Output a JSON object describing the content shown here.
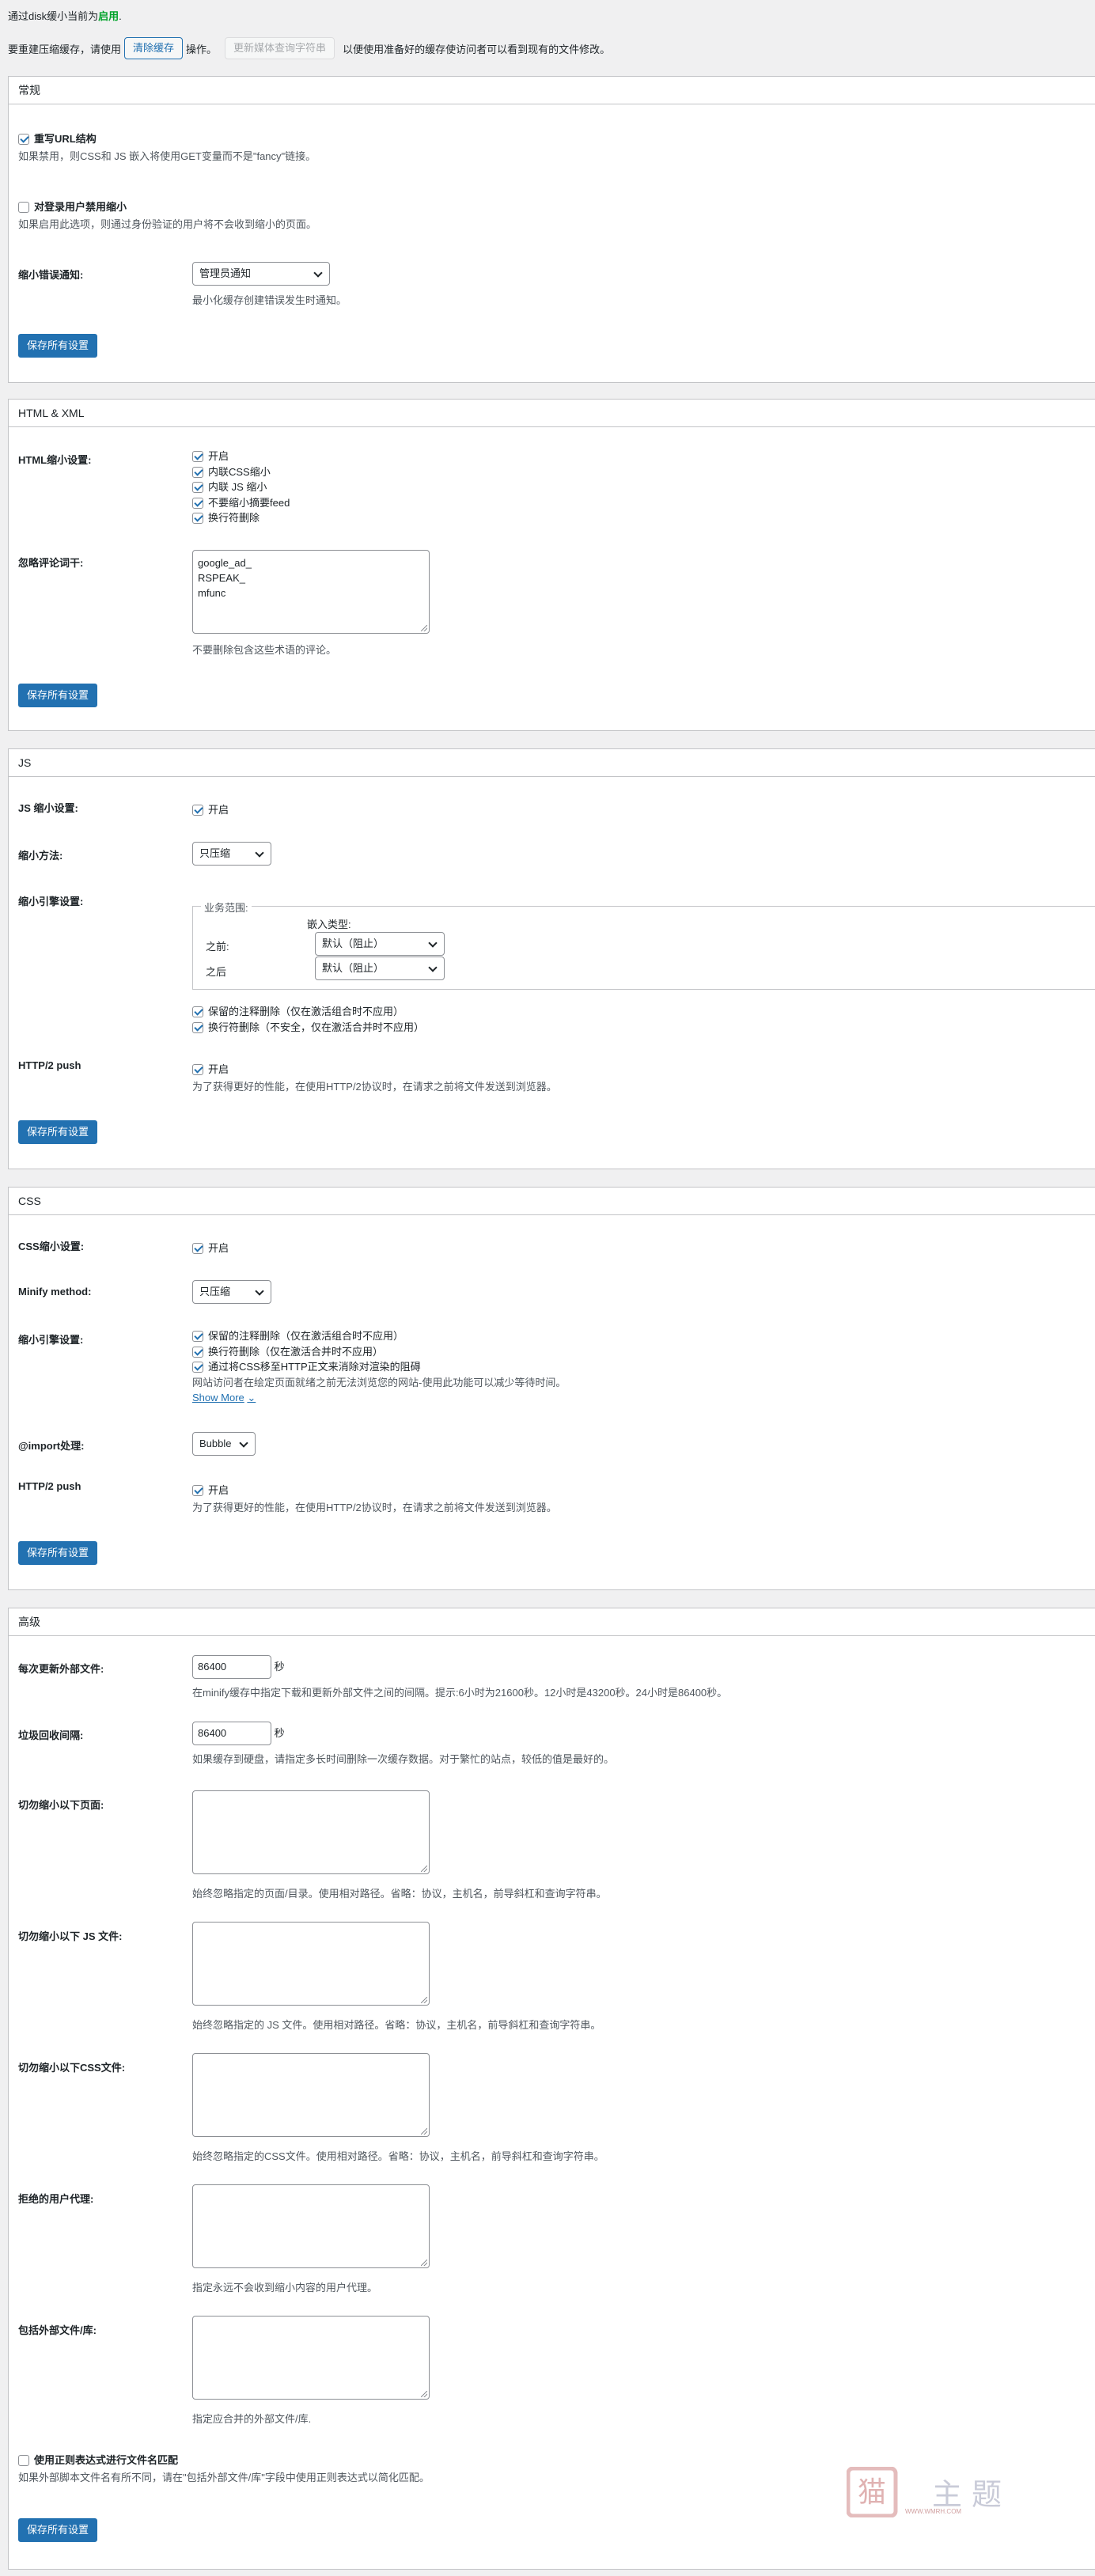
{
  "status_line": {
    "prefix": "通过disk缓小当前为",
    "status": "启用",
    "suffix": "."
  },
  "cache_row": {
    "text1": "要重建压缩缓存，请使用",
    "clear_btn": "清除缓存",
    "text2": "操作。",
    "update_btn": "更新媒体查询字符串",
    "text3": "以便使用准备好的缓存使访问者可以看到现有的文件修改。"
  },
  "save_label": "保存所有设置",
  "general": {
    "title": "常规",
    "rewrite_label": "重写URL结构",
    "rewrite_desc": "如果禁用，则CSS和 JS 嵌入将使用GET变量而不是\"fancy\"链接。",
    "disable_logged_label": "对登录用户禁用缩小",
    "disable_logged_desc": "如果启用此选项，则通过身份验证的用户将不会收到缩小的页面。",
    "error_label": "缩小错误通知:",
    "error_value": "管理员通知",
    "error_desc": "最小化缓存创建错误发生时通知。"
  },
  "html": {
    "title": "HTML & XML",
    "settings_label": "HTML缩小设置:",
    "options": [
      {
        "label": "开启",
        "checked": true
      },
      {
        "label": "内联CSS缩小",
        "checked": true
      },
      {
        "label": "内联 JS 缩小",
        "checked": true
      },
      {
        "label": "不要缩小摘要feed",
        "checked": true
      },
      {
        "label": "换行符删除",
        "checked": true
      }
    ],
    "ignore_label": "忽略评论词干:",
    "ignore_value": "google_ad_\nRSPEAK_\nmfunc",
    "ignore_desc": "不要删除包含这些术语的评论。"
  },
  "js": {
    "title": "JS",
    "settings_label": "JS 缩小设置:",
    "enable": "开启",
    "method_label": "缩小方法:",
    "method_value": "只压缩",
    "engine_label": "缩小引擎设置:",
    "fieldset_legend": "业务范围:",
    "embed_type": "嵌入类型:",
    "before_label": "之前:",
    "before_value": "默认（阻止）",
    "after_label": "之后",
    "after_value": "默认（阻止）",
    "preserve_comments": "保留的注释删除（仅在激活组合时不应用）",
    "linebreak": "换行符删除（不安全，仅在激活合并时不应用）",
    "http2_label": "HTTP/2 push",
    "http2_enable": "开启",
    "http2_desc": "为了获得更好的性能，在使用HTTP/2协议时，在请求之前将文件发送到浏览器。"
  },
  "css": {
    "title": "CSS",
    "settings_label": "CSS缩小设置:",
    "enable": "开启",
    "method_label": "Minify method:",
    "method_value": "只压缩",
    "engine_label": "缩小引擎设置:",
    "preserve_comments": "保留的注释删除（仅在激活组合时不应用）",
    "linebreak": "换行符删除（仅在激活合并时不应用）",
    "move_css": "通过将CSS移至HTTP正文来消除对渲染的阻碍",
    "move_css_desc": "网站访问者在绘定页面就绪之前无法浏览您的网站-使用此功能可以减少等待时间。",
    "show_more": "Show More",
    "import_label": "@import处理:",
    "import_value": "Bubble",
    "http2_label": "HTTP/2 push",
    "http2_enable": "开启",
    "http2_desc": "为了获得更好的性能，在使用HTTP/2协议时，在请求之前将文件发送到浏览器。"
  },
  "advanced": {
    "title": "高级",
    "update_label": "每次更新外部文件:",
    "update_value": "86400",
    "seconds": "秒",
    "update_desc": "在minify缓存中指定下载和更新外部文件之间的间隔。提示:6小时为21600秒。12小时是43200秒。24小时是86400秒。",
    "gc_label": "垃圾回收间隔:",
    "gc_value": "86400",
    "gc_desc": "如果缓存到硬盘，请指定多长时间删除一次缓存数据。对于繁忙的站点，较低的值是最好的。",
    "never_pages_label": "切勿缩小以下页面:",
    "never_pages_desc": "始终忽略指定的页面/目录。使用相对路径。省略：协议，主机名，前导斜杠和查询字符串。",
    "never_js_label": "切勿缩小以下 JS 文件:",
    "never_js_desc": "始终忽略指定的 JS 文件。使用相对路径。省略：协议，主机名，前导斜杠和查询字符串。",
    "never_css_label": "切勿缩小以下CSS文件:",
    "never_css_desc": "始终忽略指定的CSS文件。使用相对路径。省略：协议，主机名，前导斜杠和查询字符串。",
    "rejected_label": "拒绝的用户代理:",
    "rejected_desc": "指定永远不会收到缩小内容的用户代理。",
    "include_label": "包括外部文件/库:",
    "include_desc": "指定应合并的外部文件/库.",
    "regex_label": "使用正则表达式进行文件名匹配",
    "regex_desc": "如果外部脚本文件名有所不同，请在\"包括外部文件/库\"字段中使用正则表达式以简化匹配。"
  },
  "watermark": {
    "text": "主题",
    "url": "WWW.WMRH.COM"
  }
}
